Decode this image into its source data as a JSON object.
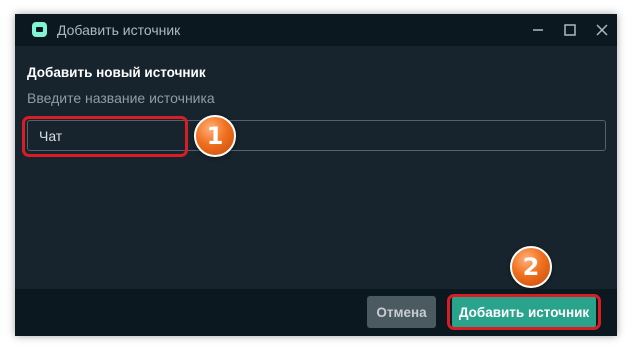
{
  "window": {
    "title": "Добавить источник",
    "app_icon": "app-logo-icon",
    "controls": [
      "minimize-icon",
      "maximize-icon",
      "close-icon"
    ]
  },
  "form": {
    "heading": "Добавить новый источник",
    "label": "Введите название источника",
    "input_value": "Чат"
  },
  "footer": {
    "cancel_label": "Отмена",
    "submit_label": "Добавить источник"
  },
  "annotations": {
    "badge_1": "1",
    "badge_2": "2",
    "highlight_color": "#d81d25",
    "badge_color": "#f0701f"
  },
  "colors": {
    "window_bg": "#17242d",
    "titlebar_bg": "#0c1820",
    "accent": "#2aa38c"
  }
}
